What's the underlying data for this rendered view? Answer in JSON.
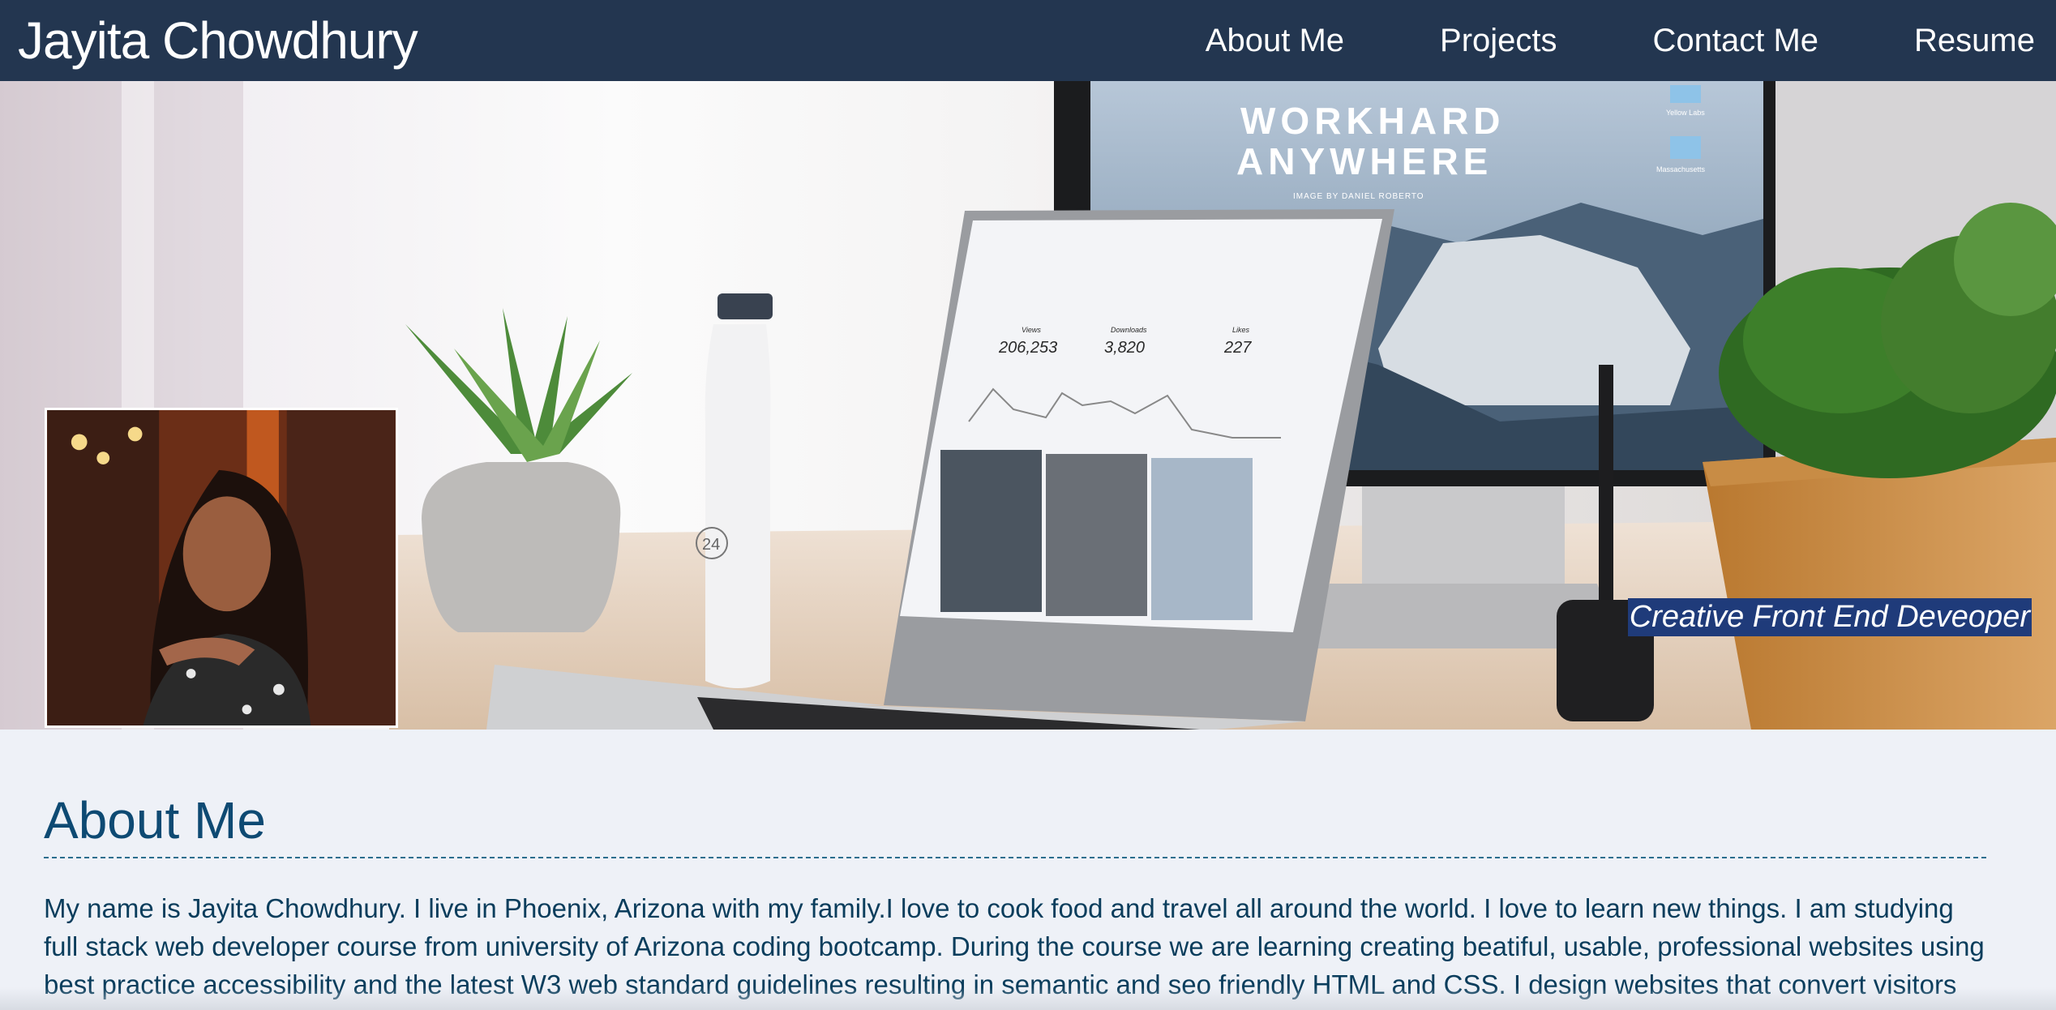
{
  "header": {
    "title": "Jayita Chowdhury",
    "nav": [
      "About Me",
      "Projects",
      "Contact Me",
      "Resume"
    ]
  },
  "hero": {
    "monitor_text_line1": "WORKHARD",
    "monitor_text_line2": "ANYWHERE",
    "monitor_credit": "IMAGE BY DANIEL ROBERTO",
    "desktop_folder_1": "Yellow Labs",
    "desktop_folder_2": "Massachusetts",
    "stats": [
      {
        "label": "Views",
        "value": "206,253"
      },
      {
        "label": "Downloads",
        "value": "3,820"
      },
      {
        "label": "Likes",
        "value": "227"
      }
    ],
    "bottle_number": "24",
    "tagline": "Creative Front End Deveoper"
  },
  "about": {
    "heading": "About Me",
    "text": "My name is Jayita Chowdhury. I live in Phoenix, Arizona with my family.I love to cook food and travel all around the world. I love to learn new things. I am studying full stack web developer course from university of Arizona coding bootcamp. During the course we are learning creating beatiful, usable, professional websites using best practice accessibility and the latest W3 web standard guidelines resulting in semantic and seo friendly HTML and CSS. I design websites that convert visitors"
  },
  "colors": {
    "header_bg": "#233650",
    "page_bg": "#eef1f7",
    "heading": "#0e4a73",
    "tagline_bg": "#1f3b7a"
  }
}
